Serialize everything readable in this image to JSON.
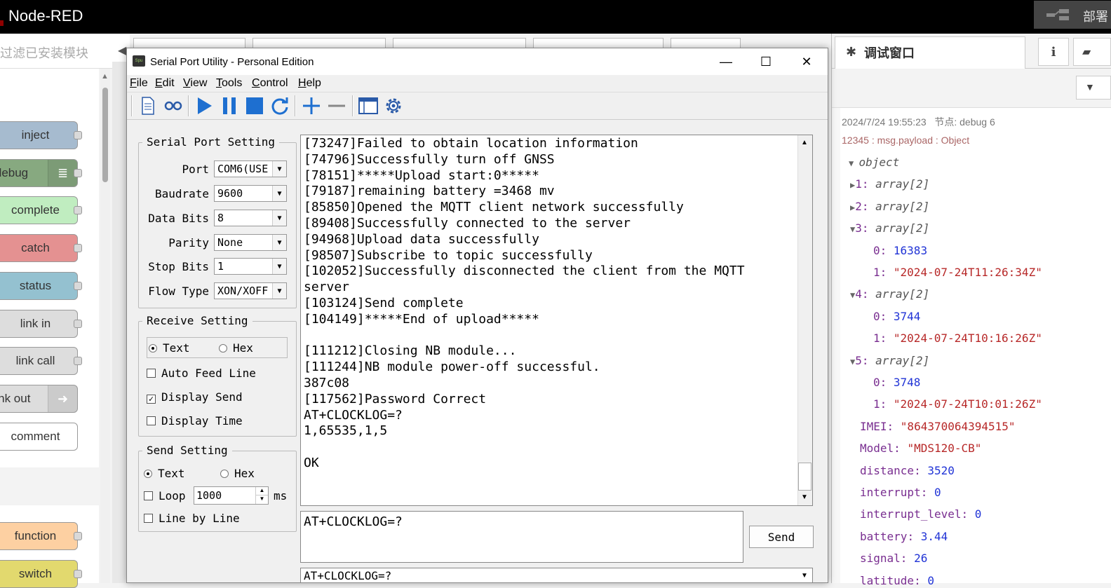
{
  "nodered": {
    "title": "Node-RED",
    "deploy_label": "部署",
    "palette_search_placeholder": "过滤已安装模块",
    "palette_nodes": [
      {
        "label": "inject",
        "color": "#a6bbcf"
      },
      {
        "label": "debug",
        "color": "#87a980"
      },
      {
        "label": "complete",
        "color": "#c0edc0"
      },
      {
        "label": "catch",
        "color": "#e49191"
      },
      {
        "label": "status",
        "color": "#94c1d0"
      },
      {
        "label": "link in",
        "color": "#dddddd"
      },
      {
        "label": "link call",
        "color": "#dddddd"
      },
      {
        "label": "link out",
        "color": "#dddddd"
      },
      {
        "label": "comment",
        "color": "#ffffff"
      },
      {
        "label": "function",
        "color": "#fdd0a2"
      },
      {
        "label": "switch",
        "color": "#e2d96e"
      }
    ]
  },
  "sidebar": {
    "title": "调试窗口",
    "info_icon": "i",
    "message": {
      "date": "2024/7/24 19:55:23",
      "node": "节点: debug 6",
      "topic": "12345 : msg.payload : Object",
      "root": "object",
      "entries": [
        {
          "key": "1",
          "type": "array[2]"
        },
        {
          "key": "2",
          "type": "array[2]"
        },
        {
          "key": "3",
          "type": "array[2]",
          "items": [
            {
              "key": "0",
              "value": "16383",
              "kind": "num"
            },
            {
              "key": "1",
              "value": "\"2024-07-24T11:26:34Z\"",
              "kind": "str"
            }
          ]
        },
        {
          "key": "4",
          "type": "array[2]",
          "items": [
            {
              "key": "0",
              "value": "3744",
              "kind": "num"
            },
            {
              "key": "1",
              "value": "\"2024-07-24T10:16:26Z\"",
              "kind": "str"
            }
          ]
        },
        {
          "key": "5",
          "type": "array[2]",
          "items": [
            {
              "key": "0",
              "value": "3748",
              "kind": "num"
            },
            {
              "key": "1",
              "value": "\"2024-07-24T10:01:26Z\"",
              "kind": "str"
            }
          ]
        }
      ],
      "fields": [
        {
          "key": "IMEI",
          "value": "\"864370064394515\"",
          "kind": "str"
        },
        {
          "key": "Model",
          "value": "\"MDS120-CB\"",
          "kind": "str"
        },
        {
          "key": "distance",
          "value": "3520",
          "kind": "num"
        },
        {
          "key": "interrupt",
          "value": "0",
          "kind": "num"
        },
        {
          "key": "interrupt_level",
          "value": "0",
          "kind": "num"
        },
        {
          "key": "battery",
          "value": "3.44",
          "kind": "num"
        },
        {
          "key": "signal",
          "value": "26",
          "kind": "num"
        },
        {
          "key": "latitude",
          "value": "0",
          "kind": "num"
        }
      ]
    }
  },
  "spu": {
    "title": "Serial Port Utility - Personal Edition",
    "menus": [
      {
        "label": "File",
        "key": "F"
      },
      {
        "label": "Edit",
        "key": "E"
      },
      {
        "label": "View",
        "key": "V"
      },
      {
        "label": "Tools",
        "key": "T"
      },
      {
        "label": "Control",
        "key": "C"
      },
      {
        "label": "Help",
        "key": "H"
      }
    ],
    "serial_setting": {
      "title": "Serial Port Setting",
      "fields": [
        {
          "label": "Port",
          "value": "COM6(USE"
        },
        {
          "label": "Baudrate",
          "value": "9600"
        },
        {
          "label": "Data Bits",
          "value": "8"
        },
        {
          "label": "Parity",
          "value": "None"
        },
        {
          "label": "Stop Bits",
          "value": "1"
        },
        {
          "label": "Flow Type",
          "value": "XON/XOFF"
        }
      ]
    },
    "receive_setting": {
      "title": "Receive Setting",
      "text_label": "Text",
      "hex_label": "Hex",
      "auto_feed_label": "Auto Feed Line",
      "display_send_label": "Display Send",
      "display_time_label": "Display Time"
    },
    "send_setting": {
      "title": "Send Setting",
      "text_label": "Text",
      "hex_label": "Hex",
      "loop_label": "Loop",
      "loop_value": "1000",
      "ms_label": "ms",
      "line_by_line_label": "Line by Line"
    },
    "receive_text": "[73247]Failed to obtain location information\n[74796]Successfully turn off GNSS\n[78151]*****Upload start:0*****\n[79187]remaining battery =3468 mv\n[85850]Opened the MQTT client network successfully\n[89408]Successfully connected to the server\n[94968]Upload data successfully\n[98507]Subscribe to topic successfully\n[102052]Successfully disconnected the client from the MQTT\nserver\n[103124]Send complete\n[104149]*****End of upload*****\n\n[111212]Closing NB module...\n[111244]NB module power-off successful.\n387c08\n[117562]Password Correct\nAT+CLOCKLOG=?\n1,65535,1,5\n\nOK",
    "send_text": "AT+CLOCKLOG=?",
    "send_button": "Send",
    "history_text": "AT+CLOCKLOG=?"
  }
}
